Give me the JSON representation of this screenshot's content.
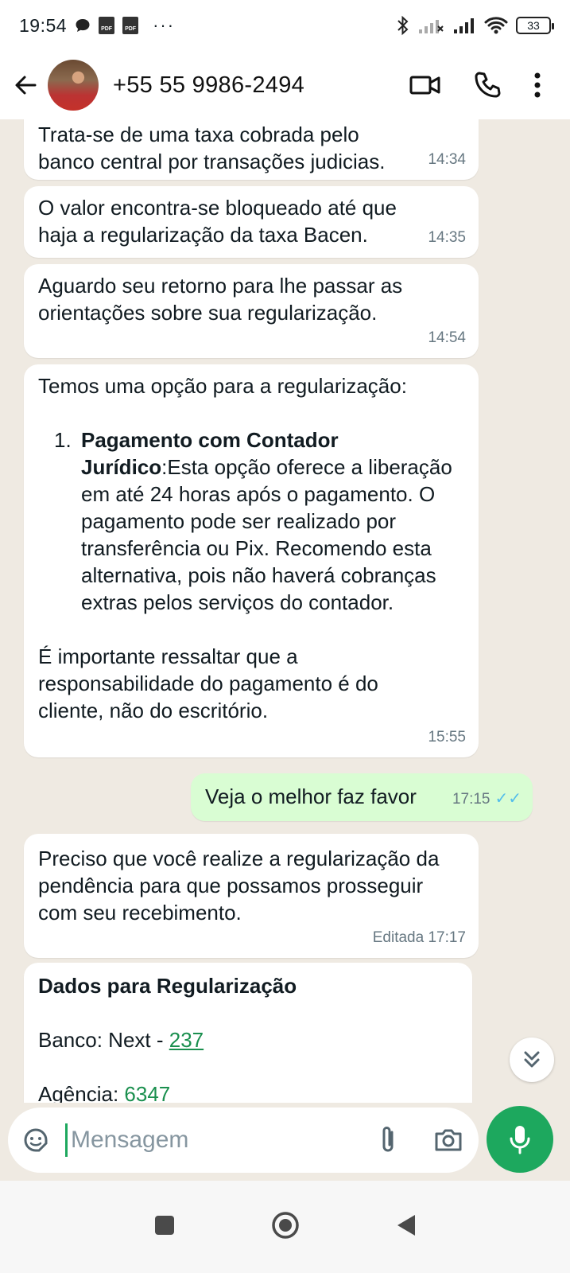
{
  "status_bar": {
    "time": "19:54",
    "more": "···",
    "battery": "33"
  },
  "header": {
    "contact": "+55 55 9986-2494"
  },
  "messages": [
    {
      "text": "Trata-se de uma taxa cobrada pelo banco central por transações judicias.",
      "time": "14:34"
    },
    {
      "text": "O valor encontra-se bloqueado até que haja a regularização da taxa Bacen.",
      "time": "14:35"
    },
    {
      "text": "Aguardo seu retorno para lhe passar as orientações sobre sua regularização.",
      "time": "14:54"
    },
    {
      "intro": "Temos uma opção para a regularização:",
      "list_number": "1.",
      "list_bold": "Pagamento com Contador Jurídico",
      "list_text": ":Esta opção oferece a liberação em até 24 horas após o pagamento. O pagamento pode ser realizado por transferência ou Pix. Recomendo esta alternativa, pois não haverá cobranças extras pelos serviços do contador.",
      "outro": "É importante ressaltar que a responsabilidade do pagamento é do cliente, não do escritório.",
      "time": "15:55"
    },
    {
      "text": "Veja o melhor faz favor",
      "time": "17:15",
      "ticks": "✓✓"
    },
    {
      "text": "Preciso que você realize a regularização da pendência para que possamos prosseguir com seu recebimento.",
      "time": "Editada 17:17"
    },
    {
      "title": "Dados para Regularização",
      "bank_label": "Banco: Next - ",
      "bank_code": "237",
      "agency_label": "Agência: ",
      "agency_code": "6347"
    }
  ],
  "input": {
    "placeholder": "Mensagem"
  },
  "colors": {
    "accent": "#1da85e",
    "outgoing_bubble": "#d9fdd3",
    "read_ticks": "#53bdeb"
  }
}
